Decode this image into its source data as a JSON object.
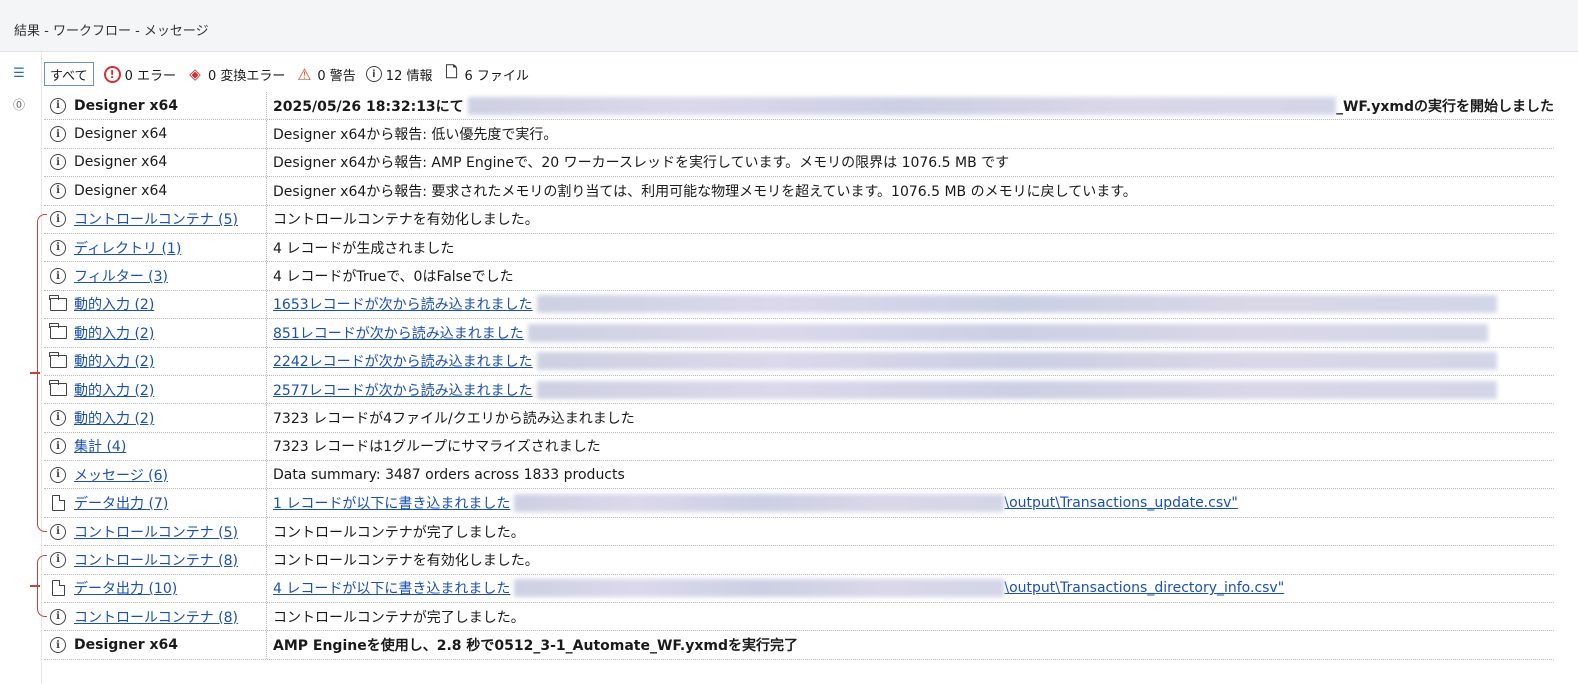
{
  "window": {
    "title": "結果 - ワークフロー - メッセージ"
  },
  "filters": {
    "all": "すべて",
    "errors": "0 エラー",
    "conversion_errors": "0 変換エラー",
    "warnings": "0 警告",
    "info": "12 情報",
    "files": "6 ファイル"
  },
  "messages": [
    {
      "icon": "info-icon",
      "tool": "Designer x64",
      "tool_link": false,
      "message": "2025/05/26 18:32:13にて",
      "suffix": "_WF.yxmdの実行を開始しました",
      "msg_link": false,
      "bold": true,
      "blur_width": 970
    },
    {
      "icon": "info-icon",
      "tool": "Designer x64",
      "tool_link": false,
      "message": "Designer x64から報告: 低い優先度で実行。",
      "suffix": "",
      "msg_link": false,
      "bold": false,
      "blur_width": 0
    },
    {
      "icon": "info-icon",
      "tool": "Designer x64",
      "tool_link": false,
      "message": "Designer x64から報告: AMP Engineで、20 ワーカースレッドを実行しています。メモリの限界は 1076.5 MB です",
      "suffix": "",
      "msg_link": false,
      "bold": false,
      "blur_width": 0
    },
    {
      "icon": "info-icon",
      "tool": "Designer x64",
      "tool_link": false,
      "message": "Designer x64から報告: 要求されたメモリの割り当ては、利用可能な物理メモリを超えています。1076.5 MB のメモリに戻しています。",
      "suffix": "",
      "msg_link": false,
      "bold": false,
      "blur_width": 0
    },
    {
      "icon": "info-icon",
      "tool": "コントロールコンテナ (5)",
      "tool_link": true,
      "message": "コントロールコンテナを有効化しました。",
      "suffix": "",
      "msg_link": false,
      "bold": false,
      "blur_width": 0
    },
    {
      "icon": "info-icon",
      "tool": "ディレクトリ (1)",
      "tool_link": true,
      "message": "4 レコードが生成されました",
      "suffix": "",
      "msg_link": false,
      "bold": false,
      "blur_width": 0
    },
    {
      "icon": "info-icon",
      "tool": "フィルター (3)",
      "tool_link": true,
      "message": "4 レコードがTrueで、0はFalseでした",
      "suffix": "",
      "msg_link": false,
      "bold": false,
      "blur_width": 0
    },
    {
      "icon": "folder-icon",
      "tool": "動的入力 (2)",
      "tool_link": true,
      "message": "1653レコードが次から読み込まれました",
      "suffix": "",
      "msg_link": true,
      "bold": false,
      "blur_width": 960
    },
    {
      "icon": "folder-icon",
      "tool": "動的入力 (2)",
      "tool_link": true,
      "message": "851レコードが次から読み込まれました",
      "suffix": "",
      "msg_link": true,
      "bold": false,
      "blur_width": 960
    },
    {
      "icon": "folder-icon",
      "tool": "動的入力 (2)",
      "tool_link": true,
      "message": "2242レコードが次から読み込まれました",
      "suffix": "",
      "msg_link": true,
      "bold": false,
      "blur_width": 960
    },
    {
      "icon": "folder-icon",
      "tool": "動的入力 (2)",
      "tool_link": true,
      "message": "2577レコードが次から読み込まれました",
      "suffix": "",
      "msg_link": true,
      "bold": false,
      "blur_width": 960
    },
    {
      "icon": "info-icon",
      "tool": "動的入力 (2)",
      "tool_link": true,
      "message": "7323 レコードが4ファイル/クエリから読み込まれました",
      "suffix": "",
      "msg_link": false,
      "bold": false,
      "blur_width": 0
    },
    {
      "icon": "info-icon",
      "tool": "集計 (4)",
      "tool_link": true,
      "message": "7323 レコードは1グループにサマライズされました",
      "suffix": "",
      "msg_link": false,
      "bold": false,
      "blur_width": 0
    },
    {
      "icon": "info-icon",
      "tool": "メッセージ (6)",
      "tool_link": true,
      "message": "Data summary: 3487 orders across 1833 products",
      "suffix": "",
      "msg_link": false,
      "bold": false,
      "blur_width": 0
    },
    {
      "icon": "file-icon",
      "tool": "データ出力 (7)",
      "tool_link": true,
      "message": "1 レコードが以下に書き込まれました",
      "suffix": "\\output\\Transactions_update.csv\"",
      "msg_link": true,
      "bold": false,
      "blur_width": 490
    },
    {
      "icon": "info-icon",
      "tool": "コントロールコンテナ (5)",
      "tool_link": true,
      "message": "コントロールコンテナが完了しました。",
      "suffix": "",
      "msg_link": false,
      "bold": false,
      "blur_width": 0
    },
    {
      "icon": "info-icon",
      "tool": "コントロールコンテナ (8)",
      "tool_link": true,
      "message": "コントロールコンテナを有効化しました。",
      "suffix": "",
      "msg_link": false,
      "bold": false,
      "blur_width": 0
    },
    {
      "icon": "file-icon",
      "tool": "データ出力 (10)",
      "tool_link": true,
      "message": "4 レコードが以下に書き込まれました",
      "suffix": "\\output\\Transactions_directory_info.csv\"",
      "msg_link": true,
      "bold": false,
      "blur_width": 490
    },
    {
      "icon": "info-icon",
      "tool": "コントロールコンテナ (8)",
      "tool_link": true,
      "message": "コントロールコンテナが完了しました。",
      "suffix": "",
      "msg_link": false,
      "bold": false,
      "blur_width": 0
    },
    {
      "icon": "info-icon",
      "tool": "Designer x64",
      "tool_link": false,
      "message": "AMP Engineを使用し、2.8 秒で0512_3-1_Automate_WF.yxmdを実行完了",
      "suffix": "",
      "msg_link": false,
      "bold": true,
      "blur_width": 0
    }
  ],
  "colors": {
    "link": "#1a4fb8",
    "annotation": "#d43a3a",
    "error": "#d92e2e",
    "warning": "#d9542e"
  }
}
